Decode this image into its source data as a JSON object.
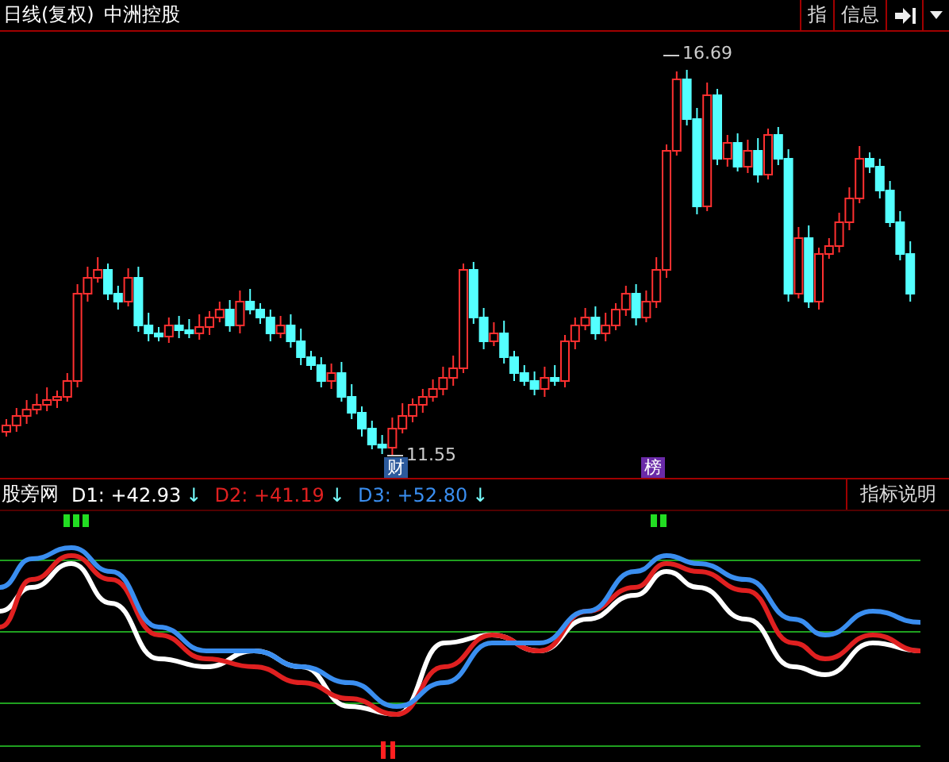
{
  "header": {
    "period": "日线(复权)",
    "stock": "中洲控股",
    "buttons": [
      {
        "kind": "text",
        "label": "指"
      },
      {
        "kind": "text",
        "label": "信息"
      },
      {
        "kind": "skip-end"
      },
      {
        "kind": "dropdown"
      }
    ]
  },
  "main_chart": {
    "price_labels": [
      {
        "kind": "high",
        "text": "16.69"
      },
      {
        "kind": "low",
        "text": "11.55"
      }
    ],
    "badges": [
      {
        "text": "财",
        "color": "#2c5a9c"
      },
      {
        "text": "榜",
        "color": "#6a2aa8"
      }
    ]
  },
  "indicator": {
    "name": "股旁网",
    "values": [
      {
        "label": "D1:",
        "value": "+42.93",
        "arrow": "↓",
        "color": "#ffffff"
      },
      {
        "label": "D2:",
        "value": "+41.19",
        "arrow": "↓",
        "color": "#e02020"
      },
      {
        "label": "D3:",
        "value": "+52.80",
        "arrow": "↓",
        "color": "#3a8ef0"
      }
    ],
    "help_button": "指标说明"
  }
}
